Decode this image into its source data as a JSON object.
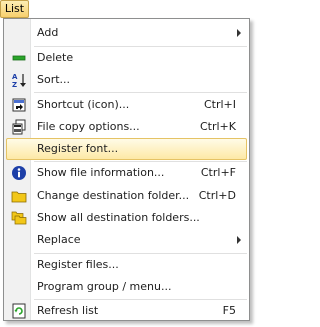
{
  "menubar": {
    "list_label": "List"
  },
  "menu": {
    "add": "Add",
    "delete": "Delete",
    "sort": "Sort...",
    "shortcut_icon": "Shortcut (icon)...",
    "shortcut_icon_key": "Ctrl+I",
    "file_copy_options": "File copy options...",
    "file_copy_options_key": "Ctrl+K",
    "register_font": "Register font...",
    "show_file_information": "Show file information...",
    "show_file_information_key": "Ctrl+F",
    "change_destination_folder": "Change destination folder...",
    "change_destination_folder_key": "Ctrl+D",
    "show_all_destination_folders": "Show all destination folders...",
    "replace": "Replace",
    "register_files": "Register files...",
    "program_group_menu": "Program group / menu...",
    "refresh_list": "Refresh list",
    "refresh_list_key": "F5"
  },
  "icons": {
    "delete": "minus-icon",
    "sort": "sort-az-icon",
    "shortcut": "shortcut-icon",
    "file_copy": "file-copy-icon",
    "info": "info-icon",
    "folder": "folder-icon",
    "folders": "folders-icon",
    "refresh": "refresh-icon"
  },
  "colors": {
    "highlight": "#fde9a6",
    "highlight_border": "#e5c365",
    "info_blue": "#1d3fa8",
    "folder_yellow": "#f2c718",
    "delete_green": "#2aa52a"
  }
}
